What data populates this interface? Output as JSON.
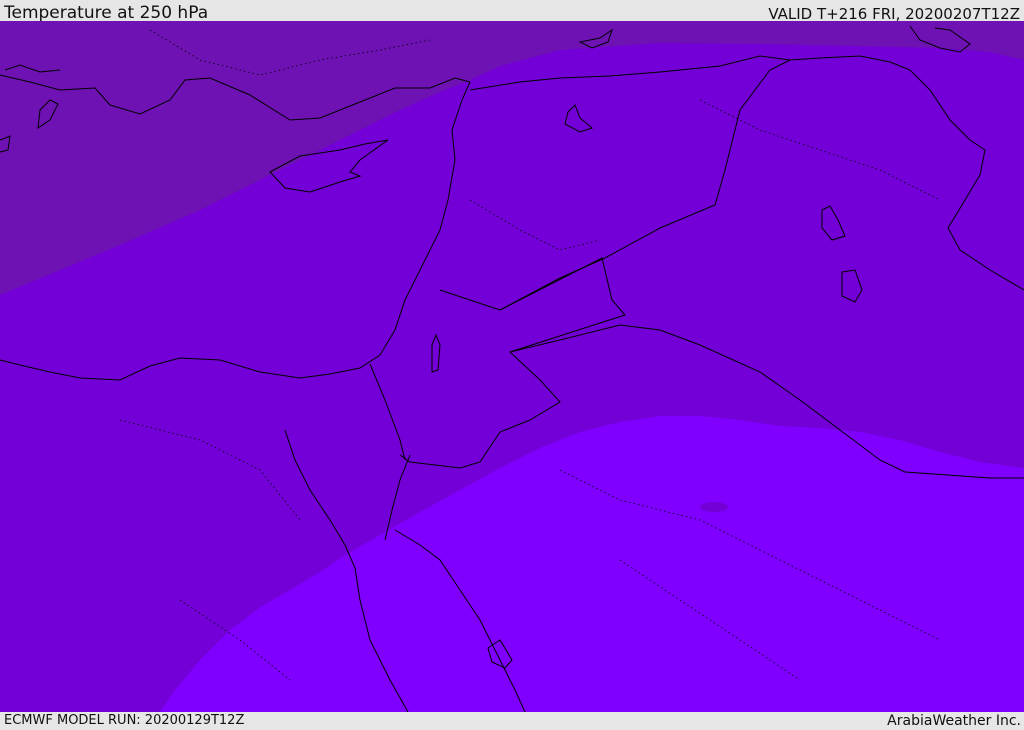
{
  "header": {
    "title": "Temperature at 250 hPa",
    "valid": "VALID T+216 FRI, 20200207T12Z"
  },
  "footer": {
    "model_run": "ECMWF MODEL RUN: 20200129T12Z",
    "brand": "ArabiaWeather Inc."
  },
  "map": {
    "colors": {
      "cold_north": "#6e12b4",
      "mid": "#7300d6",
      "warm_south": "#7f00ff",
      "coastline": "#000000"
    }
  }
}
